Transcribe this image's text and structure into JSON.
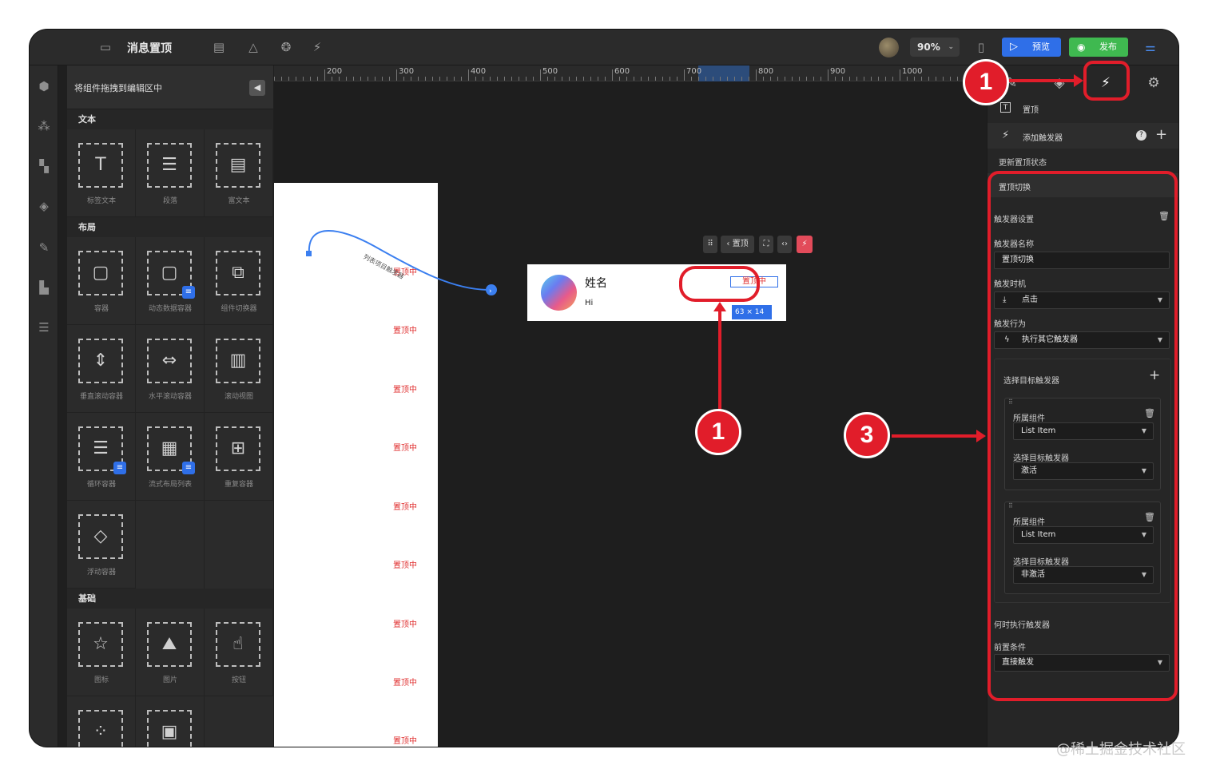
{
  "topbar": {
    "title": "消息置顶",
    "zoom": "90%",
    "preview_label": "预览",
    "publish_label": "发布",
    "icons": [
      "layout-icon",
      "document-icon",
      "triangle-icon",
      "component-icon",
      "lightning-edit-icon",
      "phone-icon",
      "settings-sliders-icon"
    ]
  },
  "left_rail": {
    "icons": [
      "cube-icon",
      "components-icon",
      "widgets-icon",
      "layers-icon",
      "tools-icon",
      "pages-icon",
      "list-icon"
    ]
  },
  "panel": {
    "title": "将组件拖拽到编辑区中",
    "sections": {
      "text": "文本",
      "layout": "布局",
      "basic": "基础"
    },
    "text_items": [
      "标签文本",
      "段落",
      "富文本"
    ],
    "layout_items": [
      "容器",
      "动态数据容器",
      "组件切换器",
      "垂直滚动容器",
      "水平滚动容器",
      "滚动视图",
      "循环容器",
      "流式布局列表",
      "重复容器",
      "浮动容器"
    ],
    "basic_items": [
      "图标",
      "图片",
      "按钮"
    ]
  },
  "canvas": {
    "ruler_labels": [
      "200",
      "300",
      "400",
      "500",
      "600",
      "700",
      "800",
      "900",
      "1000"
    ],
    "connector_label": "列表项目触发器",
    "pin_texts": [
      "置顶中",
      "置顶中",
      "置顶中",
      "置顶中",
      "置顶中",
      "置顶中",
      "置顶中",
      "置顶中",
      "置顶中"
    ],
    "float_toolbar": {
      "back_label": "置顶"
    },
    "card": {
      "name": "姓名",
      "subtitle": "Hi",
      "pin_label": "置顶中",
      "size_chip": "63 × 14"
    }
  },
  "right_panel": {
    "component_label": "置顶",
    "add_trigger_label": "添加触发器",
    "update_state_label": "更新置顶状态",
    "trigger_header": "置顶切换",
    "trigger_settings_label": "触发器设置",
    "trigger_name_label": "触发器名称",
    "trigger_name_value": "置顶切换",
    "trigger_time_label": "触发时机",
    "trigger_time_value": "点击",
    "trigger_action_label": "触发行为",
    "trigger_action_value": "执行其它触发器",
    "select_target_label": "选择目标触发器",
    "targets": [
      {
        "owner_label": "所属组件",
        "owner_value": "List Item",
        "target_label": "选择目标触发器",
        "target_value": "激活"
      },
      {
        "owner_label": "所属组件",
        "owner_value": "List Item",
        "target_label": "选择目标触发器",
        "target_value": "非激活"
      }
    ],
    "when_label": "何时执行触发器",
    "precondition_label": "前置条件",
    "precondition_value": "直接触发"
  },
  "annotations": {
    "badge_1": "1",
    "badge_1b": "1",
    "badge_3": "3",
    "accent_color": "#e11d2a"
  },
  "watermark": "@稀土掘金技术社区"
}
